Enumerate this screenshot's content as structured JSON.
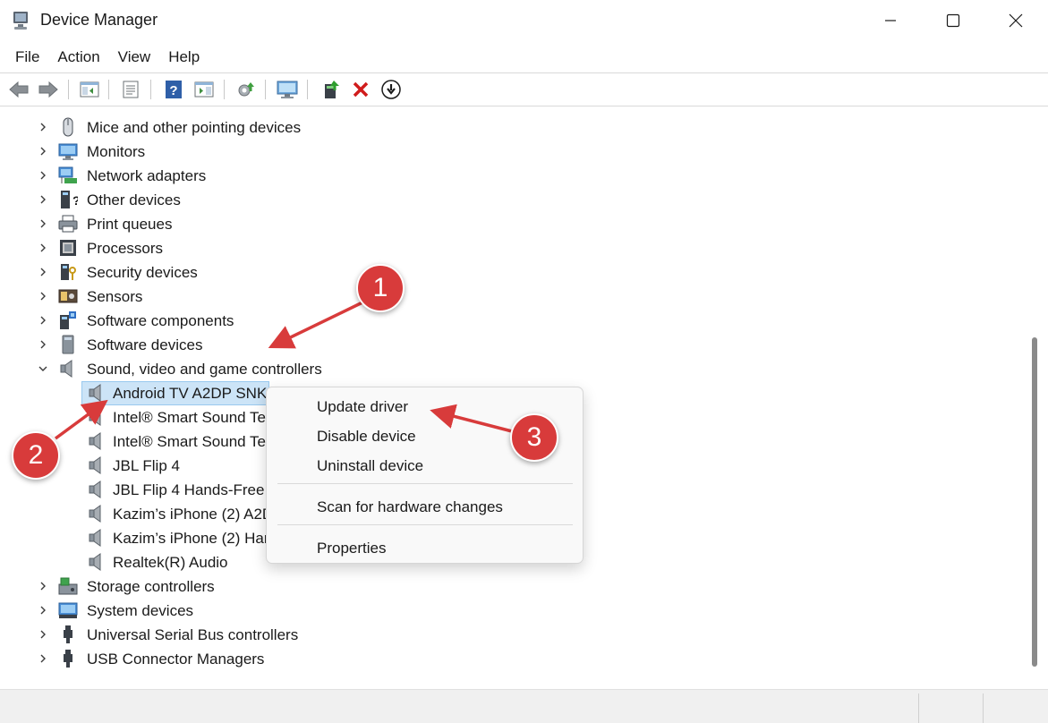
{
  "window": {
    "title": "Device Manager",
    "minimize_icon": "minimize-icon",
    "maximize_icon": "maximize-icon",
    "close_icon": "close-icon"
  },
  "menu": [
    "File",
    "Action",
    "View",
    "Help"
  ],
  "toolbar": {
    "icons": [
      "back-arrow-icon",
      "forward-arrow-icon",
      "show-hide-console-tree-icon",
      "properties-icon",
      "help-icon",
      "action-pane-icon",
      "scan-hardware-icon",
      "computer-monitor-icon",
      "update-driver-icon",
      "uninstall-device-icon",
      "disable-device-icon"
    ]
  },
  "tree": {
    "categories_before": [
      {
        "label": "Mice and other pointing devices",
        "icon": "mouse-icon"
      },
      {
        "label": "Monitors",
        "icon": "monitor-icon"
      },
      {
        "label": "Network adapters",
        "icon": "network-adapter-icon"
      },
      {
        "label": "Other devices",
        "icon": "other-devices-icon"
      },
      {
        "label": "Print queues",
        "icon": "printer-icon"
      },
      {
        "label": "Processors",
        "icon": "processor-icon"
      },
      {
        "label": "Security devices",
        "icon": "security-device-icon"
      },
      {
        "label": "Sensors",
        "icon": "sensor-icon"
      },
      {
        "label": "Software components",
        "icon": "software-component-icon"
      },
      {
        "label": "Software devices",
        "icon": "software-device-icon"
      }
    ],
    "expanded_category": {
      "label": "Sound, video and game controllers",
      "icon": "speaker-icon"
    },
    "children": [
      "Android TV A2DP SNK",
      "Intel® Smart Sound Te",
      "Intel® Smart Sound Te",
      "JBL Flip 4",
      "JBL Flip 4 Hands-Free",
      "Kazim’s iPhone (2) A2D",
      "Kazim’s iPhone (2) Har",
      "Realtek(R) Audio"
    ],
    "categories_after": [
      {
        "label": "Storage controllers",
        "icon": "storage-controller-icon"
      },
      {
        "label": "System devices",
        "icon": "system-device-icon"
      },
      {
        "label": "Universal Serial Bus controllers",
        "icon": "usb-icon"
      },
      {
        "label": "USB Connector Managers",
        "icon": "usb-icon"
      }
    ]
  },
  "context_menu": {
    "items": [
      "Update driver",
      "Disable device",
      "Uninstall device",
      "Scan for hardware changes",
      "Properties"
    ]
  },
  "callouts": [
    "1",
    "2",
    "3"
  ],
  "colors": {
    "accent_red": "#d83b3b",
    "selection": "#cce4f7"
  }
}
